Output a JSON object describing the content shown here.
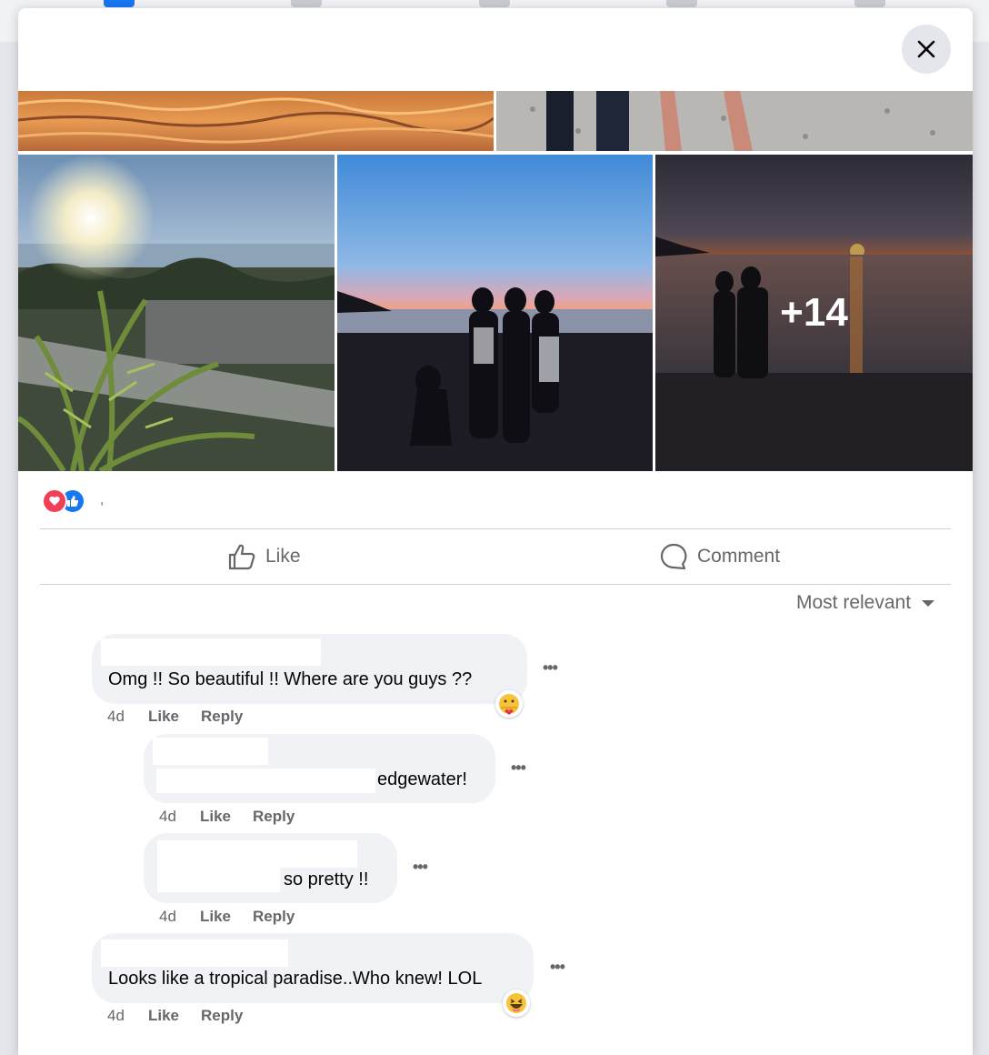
{
  "gallery": {
    "more_count": "+14"
  },
  "actions": {
    "like_label": "Like",
    "comment_label": "Comment"
  },
  "sort": {
    "label": "Most relevant"
  },
  "comments": [
    {
      "text": "Omg !! So beautiful !! Where are you guys ??",
      "age": "4d",
      "like": "Like",
      "reply": "Reply",
      "reaction": "care-emoji-icon"
    },
    {
      "text": "edgewater!",
      "age": "4d",
      "like": "Like",
      "reply": "Reply"
    },
    {
      "text": "so pretty !!",
      "age": "4d",
      "like": "Like",
      "reply": "Reply"
    },
    {
      "text": "Looks like a tropical paradise..Who knew! LOL",
      "age": "4d",
      "like": "Like",
      "reply": "Reply",
      "reaction": "haha-emoji-icon"
    }
  ],
  "colors": {
    "love": "#f33e58",
    "like": "#1877f2",
    "bubble": "#f0f2f5",
    "muted": "#65676b"
  }
}
